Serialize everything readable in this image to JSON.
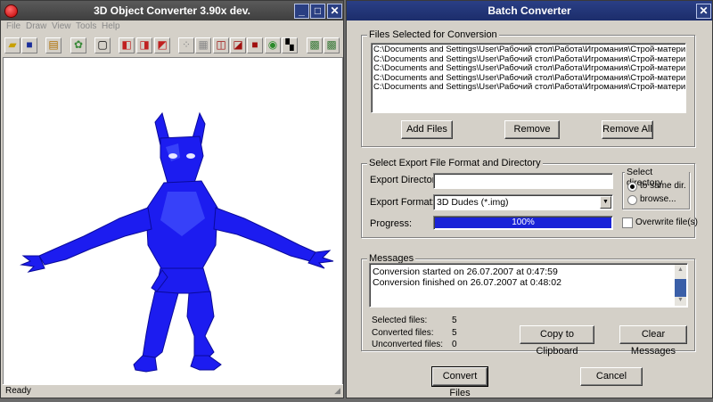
{
  "left_window": {
    "title": "3D Object Converter 3.90x dev.",
    "menu": [
      "File",
      "Draw",
      "View",
      "Tools",
      "Help"
    ],
    "toolbar_icons": [
      "open-folder-icon",
      "save-icon",
      "convert-icon",
      "settings-icon",
      "frame-icon",
      "view-front-icon",
      "view-side-icon",
      "view-top-icon",
      "grid-points-icon",
      "grid-icon",
      "cube-outline-icon",
      "cube-icon",
      "cube-solid-icon",
      "shaded-icon",
      "texture-icon",
      "wire-a-icon",
      "wire-b-icon"
    ],
    "status": "Ready",
    "model_color": "#1c1cf0"
  },
  "batch": {
    "title": "Batch Converter",
    "files_group": "Files Selected for Conversion",
    "files": [
      "C:\\Documents and Settings\\User\\Рабочий стол\\Работа\\Игромания\\Строй-материалы\\Мо",
      "C:\\Documents and Settings\\User\\Рабочий стол\\Работа\\Игромания\\Строй-материалы\\Мо",
      "C:\\Documents and Settings\\User\\Рабочий стол\\Работа\\Игромания\\Строй-материалы\\Мо",
      "C:\\Documents and Settings\\User\\Рабочий стол\\Работа\\Игромания\\Строй-материалы\\Мо",
      "C:\\Documents and Settings\\User\\Рабочий стол\\Работа\\Игромания\\Строй-материалы\\Мо"
    ],
    "add_files": "Add Files",
    "remove": "Remove",
    "remove_all": "Remove All",
    "export_group": "Select Export File Format and Directory",
    "export_dir_label": "Export Directory:",
    "export_dir_value": "",
    "export_format_label": "Export Format:",
    "export_format_value": "3D Dudes (*.img)",
    "progress_label": "Progress:",
    "progress_text": "100%",
    "progress_fraction": 1.0,
    "select_dir_group": "Select directory",
    "radio_same": "to same dir.",
    "radio_browse": "browse...",
    "overwrite_label": "Overwrite file(s)",
    "messages_group": "Messages",
    "messages": [
      "Conversion started on 26.07.2007 at 0:47:59",
      "Conversion finished on 26.07.2007 at 0:48:02"
    ],
    "selected_label": "Selected files:",
    "selected_value": "5",
    "converted_label": "Converted files:",
    "converted_value": "5",
    "unconverted_label": "Unconverted files:",
    "unconverted_value": "0",
    "copy_clipboard": "Copy to Clipboard",
    "clear_messages": "Clear Messages",
    "convert_files": "Convert Files",
    "cancel": "Cancel",
    "progress_color": "#1a23d8"
  }
}
